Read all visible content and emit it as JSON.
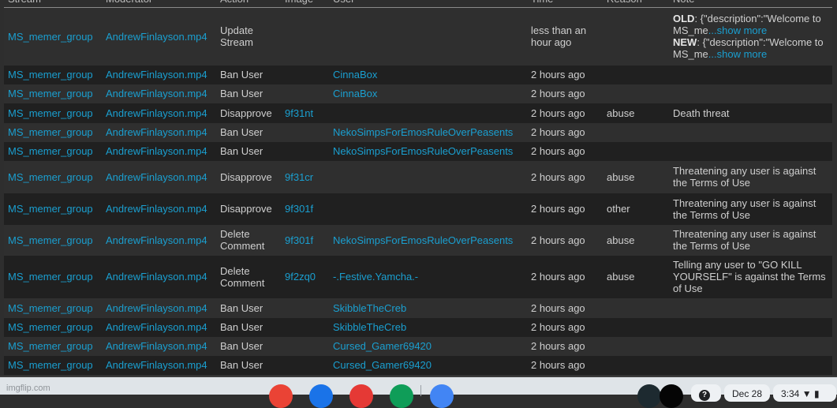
{
  "table": {
    "headers": [
      "Stream",
      "Moderator",
      "Action",
      "Image",
      "User",
      "Time",
      "Reason",
      "Note"
    ],
    "rows": [
      {
        "stream": "MS_memer_group",
        "moderator": "AndrewFinlayson.mp4",
        "action": "Update Stream",
        "image": "",
        "user": "",
        "time": "less than an hour ago",
        "reason": "",
        "note_old_label": "OLD",
        "note_old_text": ": {\"description\":\"Welcome to MS_me",
        "note_new_label": "NEW",
        "note_new_text": ": {\"description\":\"Welcome to MS_me",
        "show_more": "...show more",
        "note": ""
      },
      {
        "stream": "MS_memer_group",
        "moderator": "AndrewFinlayson.mp4",
        "action": "Ban User",
        "image": "",
        "user": "CinnaBox",
        "time": "2 hours ago",
        "reason": "",
        "note": ""
      },
      {
        "stream": "MS_memer_group",
        "moderator": "AndrewFinlayson.mp4",
        "action": "Ban User",
        "image": "",
        "user": "CinnaBox",
        "time": "2 hours ago",
        "reason": "",
        "note": ""
      },
      {
        "stream": "MS_memer_group",
        "moderator": "AndrewFinlayson.mp4",
        "action": "Disapprove",
        "image": "9f31nt",
        "user": "",
        "time": "2 hours ago",
        "reason": "abuse",
        "note": "Death threat"
      },
      {
        "stream": "MS_memer_group",
        "moderator": "AndrewFinlayson.mp4",
        "action": "Ban User",
        "image": "",
        "user": "NekoSimpsForEmosRuleOverPeasents",
        "time": "2 hours ago",
        "reason": "",
        "note": ""
      },
      {
        "stream": "MS_memer_group",
        "moderator": "AndrewFinlayson.mp4",
        "action": "Ban User",
        "image": "",
        "user": "NekoSimpsForEmosRuleOverPeasents",
        "time": "2 hours ago",
        "reason": "",
        "note": ""
      },
      {
        "stream": "MS_memer_group",
        "moderator": "AndrewFinlayson.mp4",
        "action": "Disapprove",
        "image": "9f31cr",
        "user": "",
        "time": "2 hours ago",
        "reason": "abuse",
        "note": "Threatening any user is against the Terms of Use"
      },
      {
        "stream": "MS_memer_group",
        "moderator": "AndrewFinlayson.mp4",
        "action": "Disapprove",
        "image": "9f301f",
        "user": "",
        "time": "2 hours ago",
        "reason": "other",
        "note": "Threatening any user is against the Terms of Use"
      },
      {
        "stream": "MS_memer_group",
        "moderator": "AndrewFinlayson.mp4",
        "action": "Delete Comment",
        "image": "9f301f",
        "user": "NekoSimpsForEmosRuleOverPeasents",
        "time": "2 hours ago",
        "reason": "abuse",
        "note": "Threatening any user is against the Terms of Use"
      },
      {
        "stream": "MS_memer_group",
        "moderator": "AndrewFinlayson.mp4",
        "action": "Delete Comment",
        "image": "9f2zq0",
        "user": "-.Festive.Yamcha.-",
        "time": "2 hours ago",
        "reason": "abuse",
        "note": "Telling any user to \"GO KILL YOURSELF\" is against the Terms of Use"
      },
      {
        "stream": "MS_memer_group",
        "moderator": "AndrewFinlayson.mp4",
        "action": "Ban User",
        "image": "",
        "user": "SkibbleTheCreb",
        "time": "2 hours ago",
        "reason": "",
        "note": ""
      },
      {
        "stream": "MS_memer_group",
        "moderator": "AndrewFinlayson.mp4",
        "action": "Ban User",
        "image": "",
        "user": "SkibbleTheCreb",
        "time": "2 hours ago",
        "reason": "",
        "note": ""
      },
      {
        "stream": "MS_memer_group",
        "moderator": "AndrewFinlayson.mp4",
        "action": "Ban User",
        "image": "",
        "user": "Cursed_Gamer69420",
        "time": "2 hours ago",
        "reason": "",
        "note": ""
      },
      {
        "stream": "MS_memer_group",
        "moderator": "AndrewFinlayson.mp4",
        "action": "Ban User",
        "image": "",
        "user": "Cursed_Gamer69420",
        "time": "2 hours ago",
        "reason": "",
        "note": ""
      }
    ]
  },
  "colors": {
    "link": "#1a9fd0",
    "row_odd": "#2f2f2f",
    "row_even": "#202020"
  },
  "watermark": "imgflip.com",
  "taskbar": {
    "apps": [
      {
        "name": "chrome-icon",
        "color": "#ea4335"
      },
      {
        "name": "files-icon",
        "color": "#1a73e8"
      },
      {
        "name": "pinwheel-app-icon",
        "color": "#e53935"
      },
      {
        "name": "classroom-icon",
        "color": "#0f9d58"
      },
      {
        "name": "tag-app-icon",
        "color": "#4285f4"
      }
    ],
    "date": "Dec 28",
    "time": "3:34"
  }
}
